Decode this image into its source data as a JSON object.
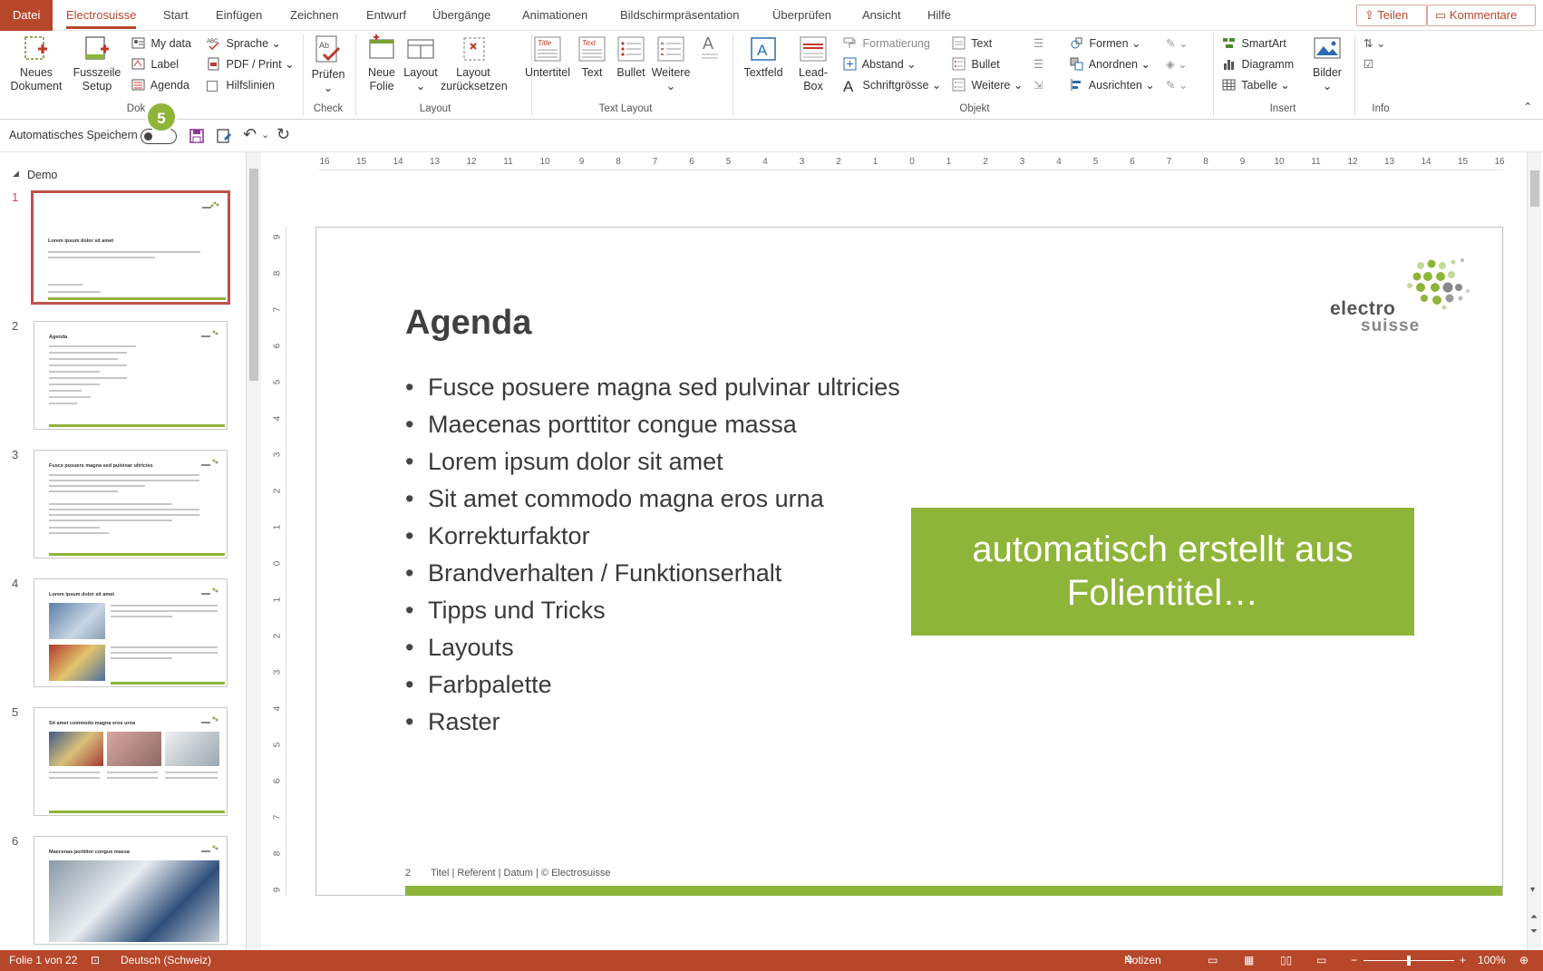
{
  "tabs": {
    "items": [
      {
        "label": "Datei"
      },
      {
        "label": "Electrosuisse"
      },
      {
        "label": "Start"
      },
      {
        "label": "Einfügen"
      },
      {
        "label": "Zeichnen"
      },
      {
        "label": "Entwurf"
      },
      {
        "label": "Übergänge"
      },
      {
        "label": "Animationen"
      },
      {
        "label": "Bildschirmpräsentation"
      },
      {
        "label": "Überprüfen"
      },
      {
        "label": "Ansicht"
      },
      {
        "label": "Hilfe"
      }
    ],
    "share_label": "Teilen",
    "comments_label": "Kommentare"
  },
  "ribbon": {
    "neues_dokument": "Neues Dokument",
    "fusszeile_setup": "Fusszeile Setup",
    "my_data": "My data",
    "label": "Label",
    "agenda": "Agenda",
    "sprache": "Sprache",
    "pdf_print": "PDF / Print",
    "hilfslinien": "Hilfslinien",
    "pruefen": "Prüfen",
    "neue_folie": "Neue Folie",
    "layout": "Layout",
    "layout_reset": "Layout zurücksetzen",
    "untertitel": "Untertitel",
    "text": "Text",
    "bullet": "Bullet",
    "weitere": "Weitere",
    "textfeld": "Textfeld",
    "lead_box": "Lead-Box",
    "formatierung": "Formatierung",
    "abstand": "Abstand",
    "schriftgroesse": "Schriftgrösse",
    "obj_text": "Text",
    "obj_bullet": "Bullet",
    "obj_weitere": "Weitere",
    "formen": "Formen",
    "anordnen": "Anordnen",
    "ausrichten": "Ausrichten",
    "smartart": "SmartArt",
    "diagramm": "Diagramm",
    "tabelle": "Tabelle",
    "bilder": "Bilder",
    "title_icon_text": "Title",
    "text_icon_text": "Text",
    "groups": {
      "dok": "Dok",
      "check": "Check",
      "layout": "Layout",
      "text_layout": "Text Layout",
      "objekt": "Objekt",
      "insert": "Insert",
      "info": "Info"
    }
  },
  "qat": {
    "autosave_label": "Automatisches Speichern",
    "step_badge": "5"
  },
  "thumbnails": {
    "section": "Demo",
    "slides": [
      {
        "number": "1",
        "title": "Lorem ipsum dolor sit amet"
      },
      {
        "number": "2",
        "title": "Agenda"
      },
      {
        "number": "3",
        "title": "Fusce posuere magna sed pulvinar ultricies"
      },
      {
        "number": "4",
        "title": "Lorem ipsum dolor sit amet"
      },
      {
        "number": "5",
        "title": "Sit amet commodo magna eros urna"
      },
      {
        "number": "6",
        "title": "Maecenas porttitor congue massa"
      }
    ]
  },
  "ruler": {
    "h_ticks": [
      "16",
      "15",
      "14",
      "13",
      "12",
      "11",
      "10",
      "9",
      "8",
      "7",
      "6",
      "5",
      "4",
      "3",
      "2",
      "1",
      "0",
      "1",
      "2",
      "3",
      "4",
      "5",
      "6",
      "7",
      "8",
      "9",
      "10",
      "11",
      "12",
      "13",
      "14",
      "15",
      "16"
    ],
    "v_ticks": [
      "9",
      "8",
      "7",
      "6",
      "5",
      "4",
      "3",
      "2",
      "1",
      "0",
      "1",
      "2",
      "3",
      "4",
      "5",
      "6",
      "7",
      "8",
      "9"
    ]
  },
  "slide": {
    "title": "Agenda",
    "bullets": [
      "Fusce posuere magna sed pulvinar ultricies",
      "Maecenas porttitor congue massa",
      "Lorem ipsum dolor sit amet",
      "Sit amet commodo magna eros urna",
      "Korrekturfaktor",
      "Brandverhalten / Funktionserhalt",
      "Tipps und Tricks",
      "Layouts",
      "Farbpalette",
      "Raster"
    ],
    "callout_line1": "automatisch erstellt aus",
    "callout_line2": "Folientitel…",
    "logo_line1": "electro",
    "logo_line2": "suisse",
    "page_number": "2",
    "footer": "Titel | Referent | Datum | © Electrosuisse"
  },
  "status": {
    "slide_info": "Folie 1 von 22",
    "language": "Deutsch (Schweiz)",
    "notes": "Notizen",
    "zoom": "100%"
  },
  "colors": {
    "accent": "#b7472a",
    "green": "#8fb43a"
  }
}
